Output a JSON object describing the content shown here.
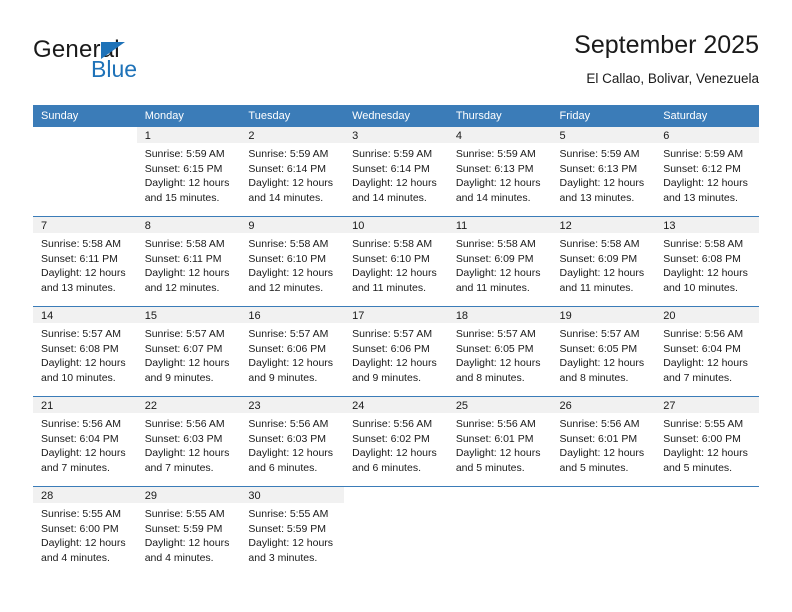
{
  "brand": {
    "name_part1": "General",
    "name_part2": "Blue",
    "triangle_color": "#1e72b8"
  },
  "header": {
    "title": "September 2025",
    "subtitle": "El Callao, Bolivar, Venezuela"
  },
  "theme": {
    "header_blue": "#3b7cb8",
    "daynum_band": "#f1f1f1",
    "text": "#1a1a1a"
  },
  "calendar": {
    "weekday_headers": [
      "Sunday",
      "Monday",
      "Tuesday",
      "Wednesday",
      "Thursday",
      "Friday",
      "Saturday"
    ],
    "labels": {
      "sunrise": "Sunrise:",
      "sunset": "Sunset:",
      "daylight": "Daylight:"
    },
    "weeks": [
      [
        {
          "day": "",
          "sunrise": "",
          "sunset": "",
          "daylight_line1": "",
          "daylight_line2": ""
        },
        {
          "day": "1",
          "sunrise": "Sunrise: 5:59 AM",
          "sunset": "Sunset: 6:15 PM",
          "daylight_line1": "Daylight: 12 hours",
          "daylight_line2": "and 15 minutes."
        },
        {
          "day": "2",
          "sunrise": "Sunrise: 5:59 AM",
          "sunset": "Sunset: 6:14 PM",
          "daylight_line1": "Daylight: 12 hours",
          "daylight_line2": "and 14 minutes."
        },
        {
          "day": "3",
          "sunrise": "Sunrise: 5:59 AM",
          "sunset": "Sunset: 6:14 PM",
          "daylight_line1": "Daylight: 12 hours",
          "daylight_line2": "and 14 minutes."
        },
        {
          "day": "4",
          "sunrise": "Sunrise: 5:59 AM",
          "sunset": "Sunset: 6:13 PM",
          "daylight_line1": "Daylight: 12 hours",
          "daylight_line2": "and 14 minutes."
        },
        {
          "day": "5",
          "sunrise": "Sunrise: 5:59 AM",
          "sunset": "Sunset: 6:13 PM",
          "daylight_line1": "Daylight: 12 hours",
          "daylight_line2": "and 13 minutes."
        },
        {
          "day": "6",
          "sunrise": "Sunrise: 5:59 AM",
          "sunset": "Sunset: 6:12 PM",
          "daylight_line1": "Daylight: 12 hours",
          "daylight_line2": "and 13 minutes."
        }
      ],
      [
        {
          "day": "7",
          "sunrise": "Sunrise: 5:58 AM",
          "sunset": "Sunset: 6:11 PM",
          "daylight_line1": "Daylight: 12 hours",
          "daylight_line2": "and 13 minutes."
        },
        {
          "day": "8",
          "sunrise": "Sunrise: 5:58 AM",
          "sunset": "Sunset: 6:11 PM",
          "daylight_line1": "Daylight: 12 hours",
          "daylight_line2": "and 12 minutes."
        },
        {
          "day": "9",
          "sunrise": "Sunrise: 5:58 AM",
          "sunset": "Sunset: 6:10 PM",
          "daylight_line1": "Daylight: 12 hours",
          "daylight_line2": "and 12 minutes."
        },
        {
          "day": "10",
          "sunrise": "Sunrise: 5:58 AM",
          "sunset": "Sunset: 6:10 PM",
          "daylight_line1": "Daylight: 12 hours",
          "daylight_line2": "and 11 minutes."
        },
        {
          "day": "11",
          "sunrise": "Sunrise: 5:58 AM",
          "sunset": "Sunset: 6:09 PM",
          "daylight_line1": "Daylight: 12 hours",
          "daylight_line2": "and 11 minutes."
        },
        {
          "day": "12",
          "sunrise": "Sunrise: 5:58 AM",
          "sunset": "Sunset: 6:09 PM",
          "daylight_line1": "Daylight: 12 hours",
          "daylight_line2": "and 11 minutes."
        },
        {
          "day": "13",
          "sunrise": "Sunrise: 5:58 AM",
          "sunset": "Sunset: 6:08 PM",
          "daylight_line1": "Daylight: 12 hours",
          "daylight_line2": "and 10 minutes."
        }
      ],
      [
        {
          "day": "14",
          "sunrise": "Sunrise: 5:57 AM",
          "sunset": "Sunset: 6:08 PM",
          "daylight_line1": "Daylight: 12 hours",
          "daylight_line2": "and 10 minutes."
        },
        {
          "day": "15",
          "sunrise": "Sunrise: 5:57 AM",
          "sunset": "Sunset: 6:07 PM",
          "daylight_line1": "Daylight: 12 hours",
          "daylight_line2": "and 9 minutes."
        },
        {
          "day": "16",
          "sunrise": "Sunrise: 5:57 AM",
          "sunset": "Sunset: 6:06 PM",
          "daylight_line1": "Daylight: 12 hours",
          "daylight_line2": "and 9 minutes."
        },
        {
          "day": "17",
          "sunrise": "Sunrise: 5:57 AM",
          "sunset": "Sunset: 6:06 PM",
          "daylight_line1": "Daylight: 12 hours",
          "daylight_line2": "and 9 minutes."
        },
        {
          "day": "18",
          "sunrise": "Sunrise: 5:57 AM",
          "sunset": "Sunset: 6:05 PM",
          "daylight_line1": "Daylight: 12 hours",
          "daylight_line2": "and 8 minutes."
        },
        {
          "day": "19",
          "sunrise": "Sunrise: 5:57 AM",
          "sunset": "Sunset: 6:05 PM",
          "daylight_line1": "Daylight: 12 hours",
          "daylight_line2": "and 8 minutes."
        },
        {
          "day": "20",
          "sunrise": "Sunrise: 5:56 AM",
          "sunset": "Sunset: 6:04 PM",
          "daylight_line1": "Daylight: 12 hours",
          "daylight_line2": "and 7 minutes."
        }
      ],
      [
        {
          "day": "21",
          "sunrise": "Sunrise: 5:56 AM",
          "sunset": "Sunset: 6:04 PM",
          "daylight_line1": "Daylight: 12 hours",
          "daylight_line2": "and 7 minutes."
        },
        {
          "day": "22",
          "sunrise": "Sunrise: 5:56 AM",
          "sunset": "Sunset: 6:03 PM",
          "daylight_line1": "Daylight: 12 hours",
          "daylight_line2": "and 7 minutes."
        },
        {
          "day": "23",
          "sunrise": "Sunrise: 5:56 AM",
          "sunset": "Sunset: 6:03 PM",
          "daylight_line1": "Daylight: 12 hours",
          "daylight_line2": "and 6 minutes."
        },
        {
          "day": "24",
          "sunrise": "Sunrise: 5:56 AM",
          "sunset": "Sunset: 6:02 PM",
          "daylight_line1": "Daylight: 12 hours",
          "daylight_line2": "and 6 minutes."
        },
        {
          "day": "25",
          "sunrise": "Sunrise: 5:56 AM",
          "sunset": "Sunset: 6:01 PM",
          "daylight_line1": "Daylight: 12 hours",
          "daylight_line2": "and 5 minutes."
        },
        {
          "day": "26",
          "sunrise": "Sunrise: 5:56 AM",
          "sunset": "Sunset: 6:01 PM",
          "daylight_line1": "Daylight: 12 hours",
          "daylight_line2": "and 5 minutes."
        },
        {
          "day": "27",
          "sunrise": "Sunrise: 5:55 AM",
          "sunset": "Sunset: 6:00 PM",
          "daylight_line1": "Daylight: 12 hours",
          "daylight_line2": "and 5 minutes."
        }
      ],
      [
        {
          "day": "28",
          "sunrise": "Sunrise: 5:55 AM",
          "sunset": "Sunset: 6:00 PM",
          "daylight_line1": "Daylight: 12 hours",
          "daylight_line2": "and 4 minutes."
        },
        {
          "day": "29",
          "sunrise": "Sunrise: 5:55 AM",
          "sunset": "Sunset: 5:59 PM",
          "daylight_line1": "Daylight: 12 hours",
          "daylight_line2": "and 4 minutes."
        },
        {
          "day": "30",
          "sunrise": "Sunrise: 5:55 AM",
          "sunset": "Sunset: 5:59 PM",
          "daylight_line1": "Daylight: 12 hours",
          "daylight_line2": "and 3 minutes."
        },
        {
          "day": "",
          "sunrise": "",
          "sunset": "",
          "daylight_line1": "",
          "daylight_line2": ""
        },
        {
          "day": "",
          "sunrise": "",
          "sunset": "",
          "daylight_line1": "",
          "daylight_line2": ""
        },
        {
          "day": "",
          "sunrise": "",
          "sunset": "",
          "daylight_line1": "",
          "daylight_line2": ""
        },
        {
          "day": "",
          "sunrise": "",
          "sunset": "",
          "daylight_line1": "",
          "daylight_line2": ""
        }
      ]
    ]
  }
}
